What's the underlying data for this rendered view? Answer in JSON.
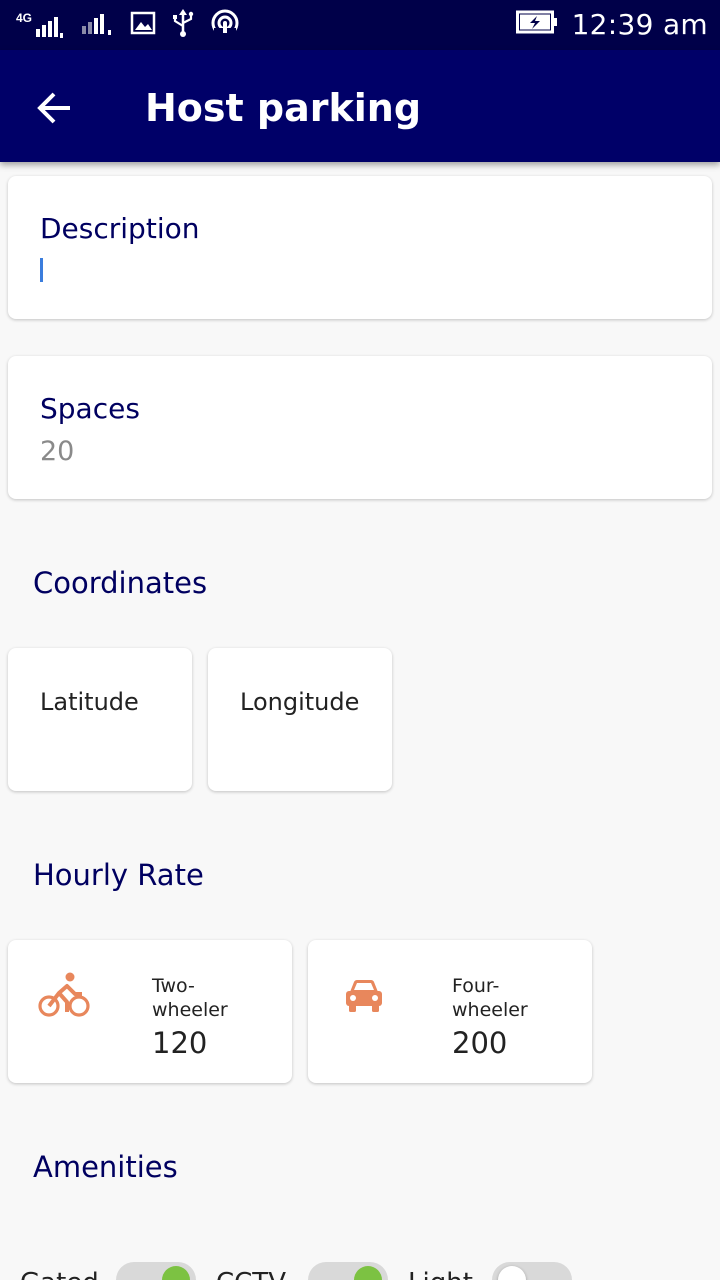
{
  "status_bar": {
    "network_label": "4G",
    "time": "12:39 am"
  },
  "app_bar": {
    "title": "Host parking",
    "back_icon": "arrow-back-icon"
  },
  "description": {
    "label": "Description",
    "value": ""
  },
  "spaces": {
    "label": "Spaces",
    "value": "20"
  },
  "coordinates": {
    "title": "Coordinates",
    "latitude_label": "Latitude",
    "longitude_label": "Longitude"
  },
  "hourly_rate": {
    "title": "Hourly Rate",
    "items": [
      {
        "icon": "bicycle-icon",
        "name_line1": "Two-",
        "name_line2": "wheeler",
        "value": "120"
      },
      {
        "icon": "car-icon",
        "name_line1": "Four-",
        "name_line2": "wheeler",
        "value": "200"
      }
    ],
    "icon_color": "#e8875c"
  },
  "amenities": {
    "title": "Amenities",
    "items": [
      {
        "label": "Gated",
        "enabled": true
      },
      {
        "label": "CCTV",
        "enabled": true
      },
      {
        "label": "Light",
        "enabled": false
      }
    ],
    "on_color": "#7cc242"
  },
  "colors": {
    "status_bar": "#000049",
    "app_bar": "#000068",
    "label": "#000060"
  }
}
